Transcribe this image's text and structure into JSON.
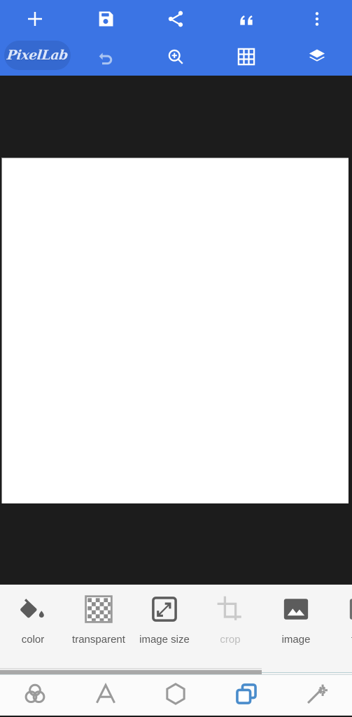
{
  "app": {
    "name": "PixelLab",
    "logo_label": "PixelLab",
    "accent_blue": "#3b74e4",
    "logo_pill_blue": "#3569d0",
    "canvas_bg": "#1c1c1c",
    "canvas_sheet_color": "#ffffff",
    "panel_bg": "#f5f5f5",
    "active_nav_color": "#4a8ccb",
    "disabled_color": "#bdbdbd"
  },
  "header": {
    "row1": [
      {
        "name": "add",
        "label": "Add",
        "icon": "plus-icon",
        "state": "enabled"
      },
      {
        "name": "save",
        "label": "Save",
        "icon": "save-floppy-icon",
        "state": "enabled"
      },
      {
        "name": "share",
        "label": "Share",
        "icon": "share-icon",
        "state": "enabled"
      },
      {
        "name": "quote",
        "label": "Quote",
        "icon": "quote-icon",
        "state": "enabled"
      },
      {
        "name": "more",
        "label": "More options",
        "icon": "overflow-menu-icon",
        "state": "enabled"
      }
    ],
    "row2": [
      {
        "name": "logo",
        "label": "PixelLab",
        "icon": "pixellab-logo",
        "state": "enabled"
      },
      {
        "name": "undo",
        "label": "Undo",
        "icon": "undo-icon",
        "state": "disabled"
      },
      {
        "name": "zoom",
        "label": "Zoom in",
        "icon": "zoom-in-icon",
        "state": "enabled"
      },
      {
        "name": "grid",
        "label": "Grid",
        "icon": "grid-icon",
        "state": "enabled"
      },
      {
        "name": "layers",
        "label": "Layers",
        "icon": "layers-icon",
        "state": "enabled"
      }
    ]
  },
  "canvas": {
    "description": "blank white image canvas"
  },
  "tools": {
    "items": [
      {
        "label": "color",
        "icon": "paint-bucket-icon",
        "state": "enabled"
      },
      {
        "label": "transparent",
        "icon": "checkerboard-icon",
        "state": "enabled"
      },
      {
        "label": "image size",
        "icon": "resize-arrows-icon",
        "state": "enabled"
      },
      {
        "label": "crop",
        "icon": "crop-icon",
        "state": "disabled"
      },
      {
        "label": "image",
        "icon": "picture-icon",
        "state": "enabled"
      },
      {
        "label": "from",
        "icon": "picture-icon",
        "state": "enabled"
      }
    ]
  },
  "scrollbar": {
    "orientation": "horizontal",
    "thumb_percent": 74
  },
  "bottom_nav": {
    "items": [
      {
        "label": "color mixer",
        "icon": "three-circles-icon",
        "active": false
      },
      {
        "label": "text",
        "icon": "letter-a-icon",
        "active": false
      },
      {
        "label": "shape",
        "icon": "hexagon-icon",
        "active": false
      },
      {
        "label": "background",
        "icon": "layers-squares-icon",
        "active": true
      },
      {
        "label": "effects",
        "icon": "magic-wand-icon",
        "active": false
      }
    ]
  }
}
